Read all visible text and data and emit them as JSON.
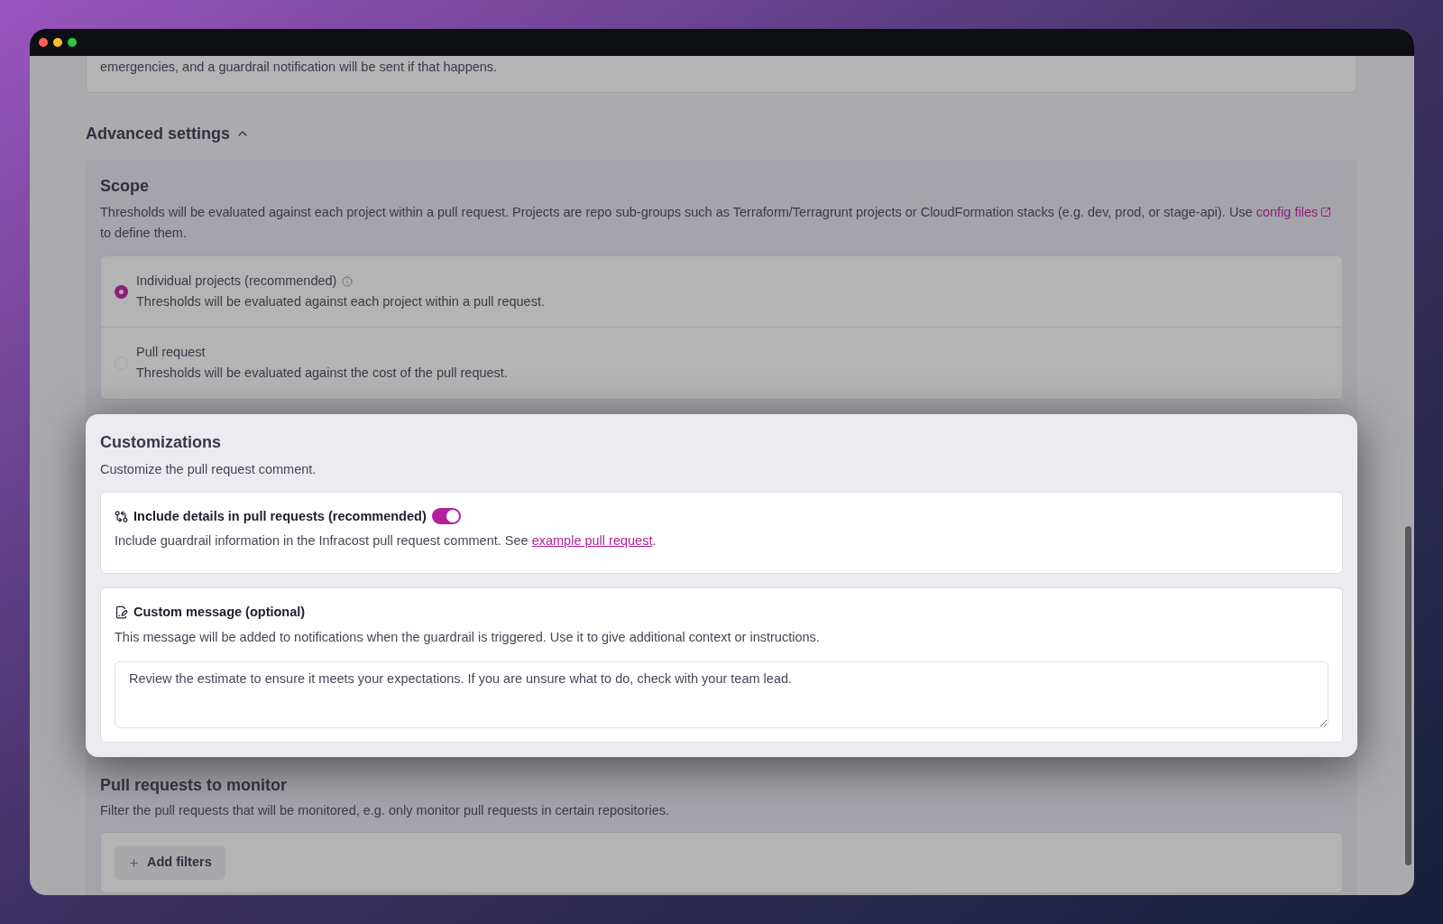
{
  "previous_card": {
    "text": "emergencies, and a guardrail notification will be sent if that happens."
  },
  "advanced_settings": {
    "label": "Advanced settings",
    "expanded": true
  },
  "scope": {
    "title": "Scope",
    "description": "Thresholds will be evaluated against each project within a pull request. Projects are repo sub-groups such as Terraform/Terragrunt projects or CloudFormation stacks (e.g. dev, prod, or stage-api). Use",
    "link": "config files",
    "description_end": "to define them.",
    "options": [
      {
        "label": "Individual projects (recommended)",
        "description": "Thresholds will be evaluated against each project within a pull request.",
        "selected": true,
        "has_info": true
      },
      {
        "label": "Pull request",
        "description": "Thresholds will be evaluated against the cost of the pull request.",
        "selected": false,
        "has_info": false
      }
    ]
  },
  "customizations": {
    "title": "Customizations",
    "description": "Customize the pull request comment.",
    "items": [
      {
        "kind": "toggle",
        "title": "Include details in pull requests (recommended)",
        "on": true,
        "description": "Include guardrail information in the Infracost pull request comment. See ",
        "link": "example pull request",
        "description_end": "."
      },
      {
        "kind": "message",
        "title": "Custom message (optional)",
        "description": "This message will be added to notifications when the guardrail is triggered. Use it to give additional context or instructions.",
        "value": "Review the estimate to ensure it meets your expectations. If you are unsure what to do, check with your team lead."
      }
    ]
  },
  "pull_requests_to_monitor": {
    "title": "Pull requests to monitor",
    "description": "Filter the pull requests that will be monitored, e.g. only monitor pull requests in certain repositories.",
    "add_button": "Add filters"
  }
}
